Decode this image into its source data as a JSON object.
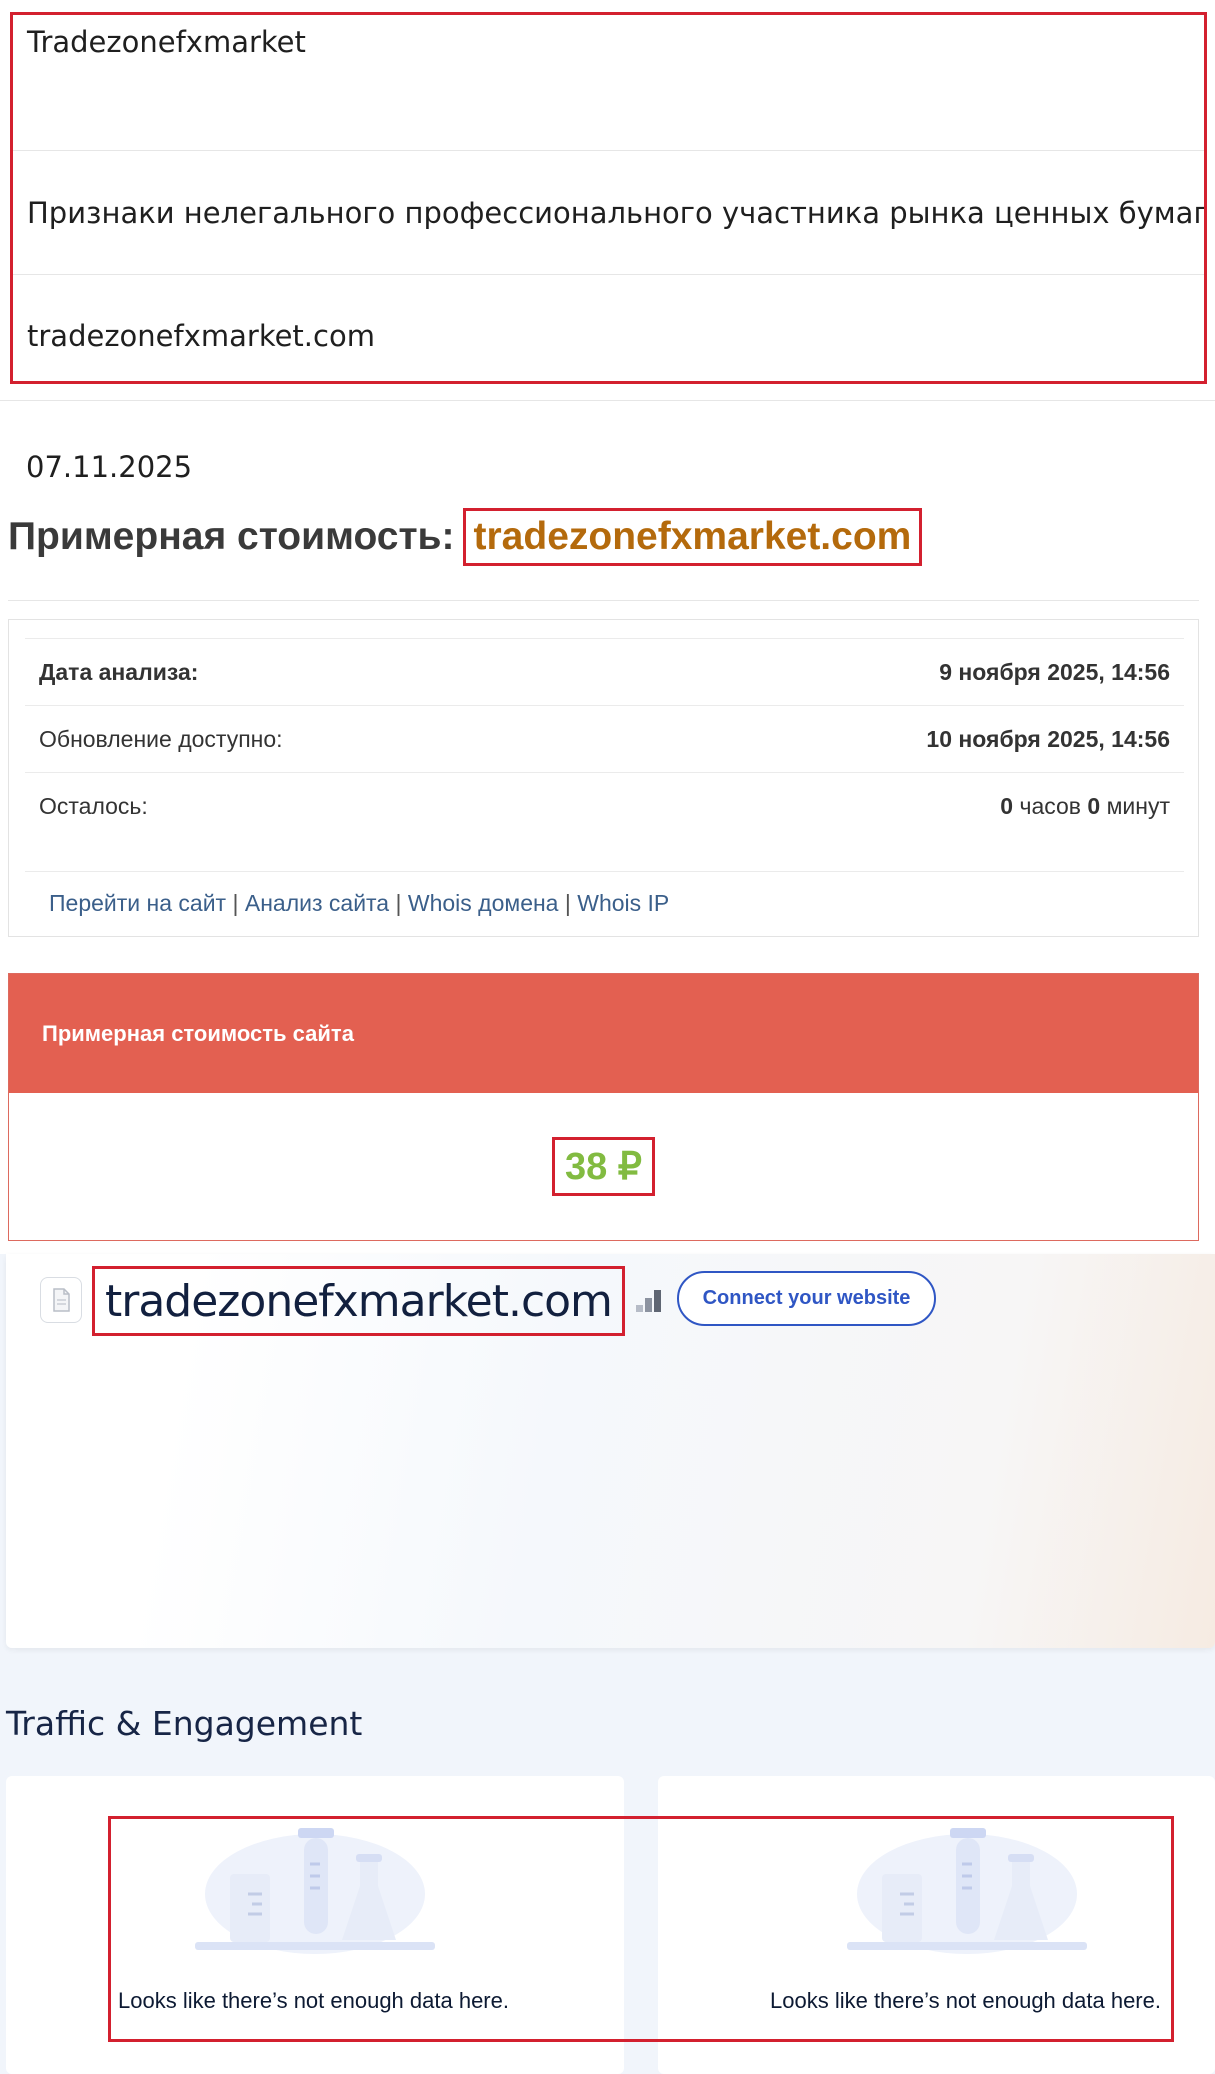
{
  "info_card": {
    "name": "Tradezonefxmarket",
    "category": "Признаки нелегального профессионального участника рынка ценных бумаг",
    "domain": "tradezonefxmarket.com"
  },
  "date": "07.11.2025",
  "cost_title": {
    "label": "Примерная стоимость:",
    "domain": "tradezonefxmarket.com"
  },
  "analysis": {
    "rows": [
      {
        "label": "Дата анализа:",
        "value": "9 ноября 2025, 14:56"
      },
      {
        "label": "Обновление доступно:",
        "value": "10 ноября 2025, 14:56"
      }
    ],
    "remaining": {
      "label": "Осталось:",
      "hours": "0",
      "hours_unit": "часов",
      "minutes": "0",
      "minutes_unit": "минут"
    },
    "links": [
      "Перейти на сайт",
      "Анализ сайта",
      "Whois домена",
      "Whois IP"
    ],
    "link_separator": "|"
  },
  "site_cost": {
    "header": "Примерная стоимость сайта",
    "value": "38 ₽"
  },
  "similarweb": {
    "domain": "tradezonefxmarket.com",
    "connect_button": "Connect your website",
    "section_title": "Traffic & Engagement",
    "empty_left": "Looks like there’s not enough data here.",
    "empty_right": "Looks like there’s not enough data here."
  },
  "colors": {
    "highlight_border": "#d3202f",
    "title_domain": "#b46a0c",
    "cost_header": "#e36051",
    "cost_value": "#82bb41",
    "link": "#3b5f8a",
    "accent_blue": "#2f56c4"
  },
  "icons": [
    "document-icon",
    "rank-bars-icon",
    "lab-flasks-illustration"
  ]
}
